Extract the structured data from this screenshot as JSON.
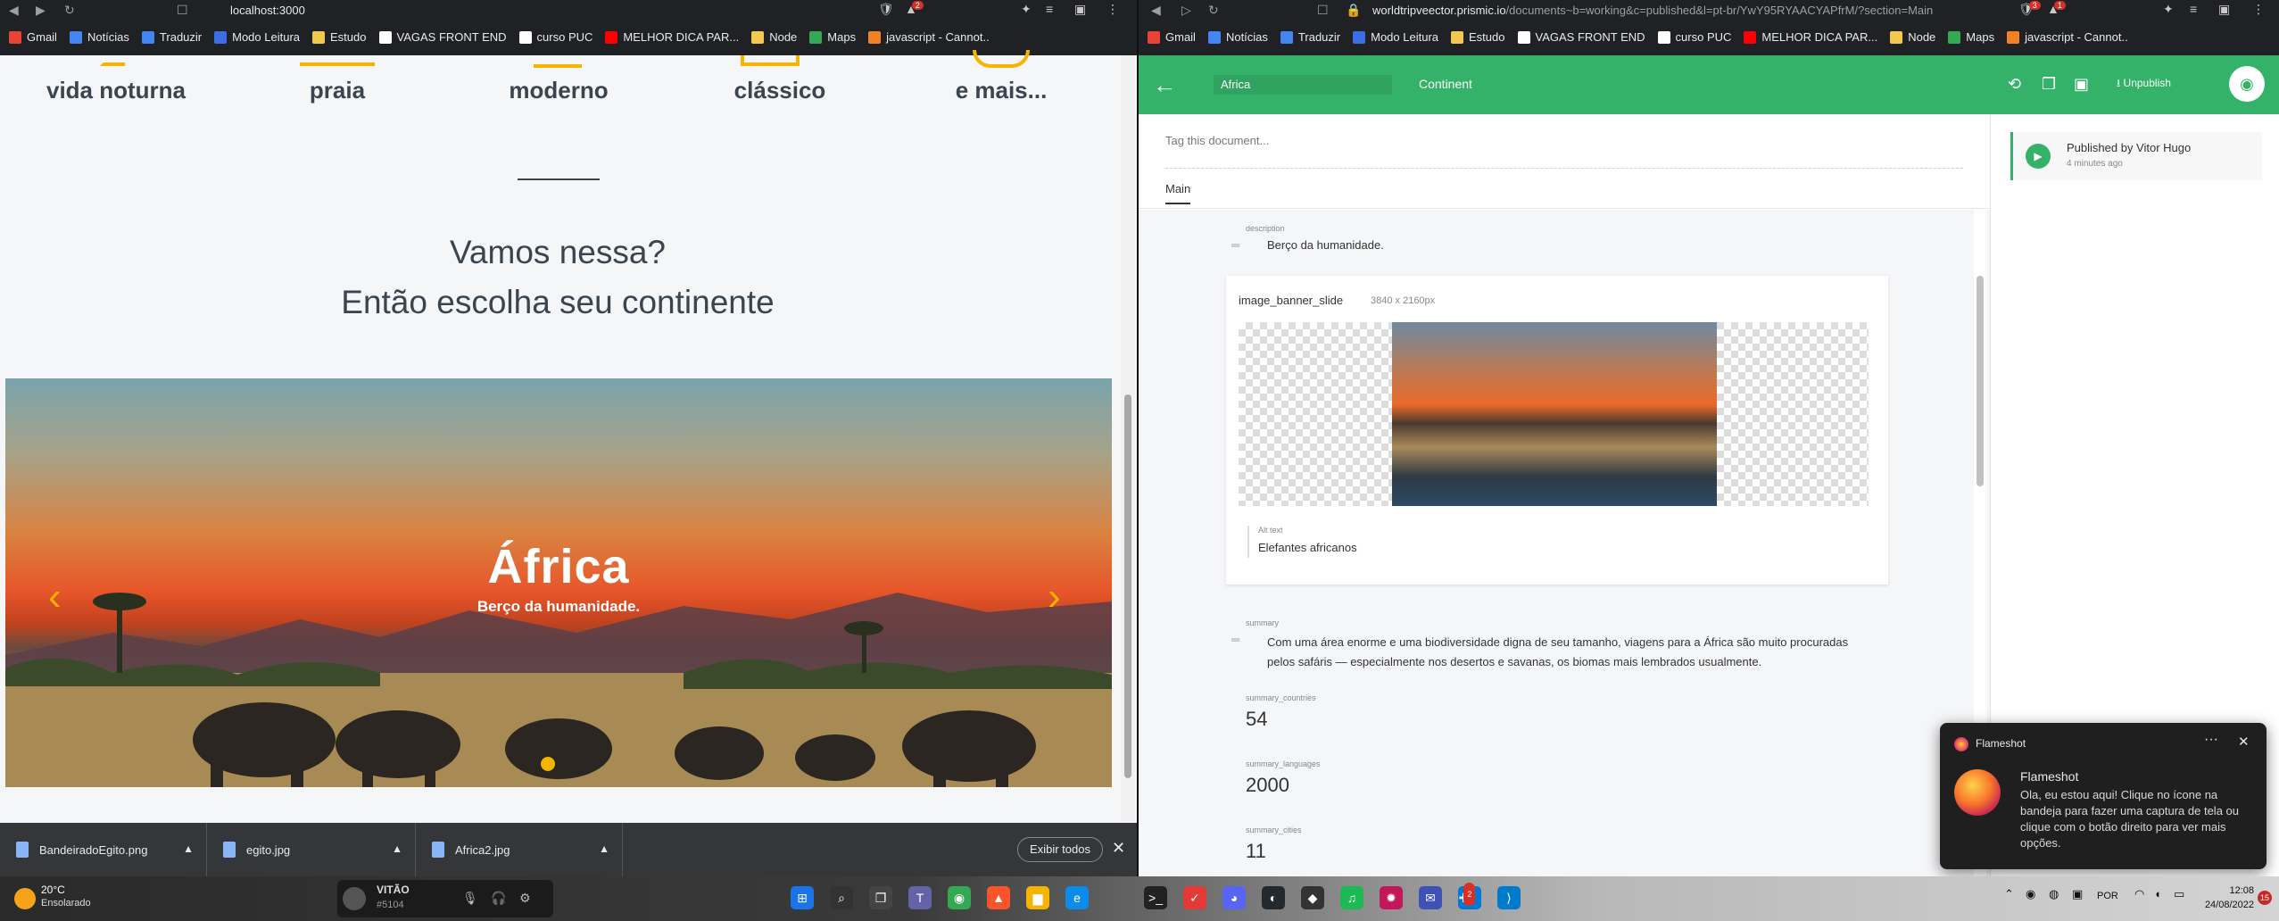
{
  "left_browser": {
    "url": "localhost:3000",
    "bookmarks": [
      {
        "label": "Gmail",
        "color": "#ea4335"
      },
      {
        "label": "Notícias",
        "color": "#4285f4"
      },
      {
        "label": "Traduzir",
        "color": "#4285f4"
      },
      {
        "label": "Modo Leitura",
        "color": "#3b6ee6"
      },
      {
        "label": "Estudo",
        "color": "#f2c94c"
      },
      {
        "label": "VAGAS FRONT END",
        "color": "#ffffff"
      },
      {
        "label": "curso PUC",
        "color": "#ffffff"
      },
      {
        "label": "MELHOR DICA PAR...",
        "color": "#ff0000"
      },
      {
        "label": "Node",
        "color": "#f2c94c"
      },
      {
        "label": "Maps",
        "color": "#34a853"
      },
      {
        "label": "javascript - Cannot..",
        "color": "#f48024"
      }
    ],
    "categories": [
      "vida noturna",
      "praia",
      "moderno",
      "clássico",
      "e mais..."
    ],
    "heading_line1": "Vamos nessa?",
    "heading_line2": "Então escolha seu continente",
    "banner": {
      "title": "África",
      "subtitle": "Berço da humanidade.",
      "prev_icon": "chevron-left-icon",
      "next_icon": "chevron-right-icon"
    },
    "downloads": [
      {
        "name": "BandeiradoEgito.png"
      },
      {
        "name": "egito.jpg"
      },
      {
        "name": "Africa2.jpg"
      }
    ],
    "show_all": "Exibir todos",
    "extension_badge": "2"
  },
  "right_browser": {
    "url_main": "worldtripveector.prismic.io",
    "url_rest": "/documents~b=working&c=published&l=pt-br/YwY95RYAACYAPfrM/?section=Main",
    "extension_badge": "3",
    "extension_badge2": "1",
    "bookmarks": [
      {
        "label": "Gmail",
        "color": "#ea4335"
      },
      {
        "label": "Notícias",
        "color": "#4285f4"
      },
      {
        "label": "Traduzir",
        "color": "#4285f4"
      },
      {
        "label": "Modo Leitura",
        "color": "#3b6ee6"
      },
      {
        "label": "Estudo",
        "color": "#f2c94c"
      },
      {
        "label": "VAGAS FRONT END",
        "color": "#ffffff"
      },
      {
        "label": "curso PUC",
        "color": "#ffffff"
      },
      {
        "label": "MELHOR DICA PAR...",
        "color": "#ff0000"
      },
      {
        "label": "Node",
        "color": "#f2c94c"
      },
      {
        "label": "Maps",
        "color": "#34a853"
      },
      {
        "label": "javascript - Cannot..",
        "color": "#f48024"
      }
    ],
    "prismic": {
      "doc_name": "Africa",
      "doc_type": "Continent",
      "unpublish": "Unpublish",
      "tag_placeholder": "Tag this document...",
      "tab_main": "Main",
      "fields": {
        "description_label": "description",
        "description_value": "Berço da humanidade.",
        "image_name": "image_banner_slide",
        "image_dims": "3840 x 2160px",
        "alt_label": "Alt text",
        "alt_value": "Elefantes africanos",
        "summary_label": "summary",
        "summary_value": "Com uma área enorme e uma biodiversidade digna de seu tamanho, viagens para a África são muito procuradas pelos safáris — especialmente nos desertos e savanas, os biomas mais lembrados usualmente.",
        "countries_label": "summary_countries",
        "countries_value": "54",
        "languages_label": "summary_languages",
        "languages_value": "2000",
        "cities_label": "summary_cities",
        "cities_value": "11"
      },
      "published_by": "Published by Vitor Hugo",
      "published_when": "4 minutes ago",
      "accent": "#35b26a"
    }
  },
  "notification": {
    "app": "Flameshot",
    "title": "Flameshot",
    "body": "Ola, eu estou aqui! Clique no ícone na bandeja para fazer uma captura de tela ou clique com o botão direito para ver mais opções."
  },
  "taskbar": {
    "temp": "20°C",
    "weather": "Ensolarado",
    "discord_name": "VITÃO",
    "discord_tag": "#5104",
    "lang": "POR",
    "time": "12:08",
    "date": "24/08/2022",
    "notif_count": "15",
    "app_badge": "2"
  }
}
